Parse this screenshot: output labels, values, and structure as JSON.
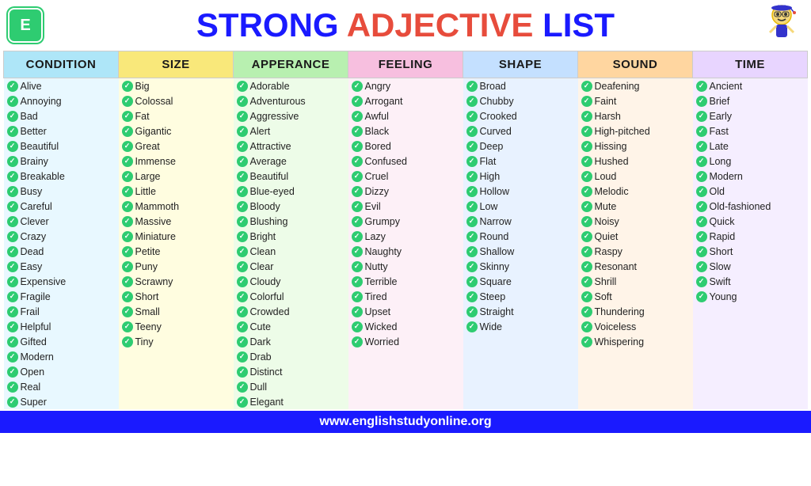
{
  "header": {
    "logo": "E",
    "title_strong": "STRONG",
    "title_adj": "ADJECTIVE",
    "title_list": "LIST"
  },
  "columns": [
    {
      "key": "condition",
      "label": "CONDITION",
      "class": "condition",
      "words": [
        "Alive",
        "Annoying",
        "Bad",
        "Better",
        "Beautiful",
        "Brainy",
        "Breakable",
        "Busy",
        "Careful",
        "Clever",
        "Crazy",
        "Dead",
        "Easy",
        "Expensive",
        "Fragile",
        "Frail",
        "Helpful",
        "Gifted",
        "Modern",
        "Open",
        "Real",
        "Super"
      ]
    },
    {
      "key": "size",
      "label": "SIZE",
      "class": "size",
      "words": [
        "Big",
        "Colossal",
        "Fat",
        "Gigantic",
        "Great",
        "Immense",
        "Large",
        "Little",
        "Mammoth",
        "Massive",
        "Miniature",
        "Petite",
        "Puny",
        "Scrawny",
        "Short",
        "Small",
        "Teeny",
        "Tiny"
      ]
    },
    {
      "key": "apperance",
      "label": "APPERANCE",
      "class": "apperance",
      "words": [
        "Adorable",
        "Adventurous",
        "Aggressive",
        "Alert",
        "Attractive",
        "Average",
        "Beautiful",
        "Blue-eyed",
        "Bloody",
        "Blushing",
        "Bright",
        "Clean",
        "Clear",
        "Cloudy",
        "Colorful",
        "Crowded",
        "Cute",
        "Dark",
        "Drab",
        "Distinct",
        "Dull",
        "Elegant"
      ]
    },
    {
      "key": "feeling",
      "label": "FEELING",
      "class": "feeling",
      "words": [
        "Angry",
        "Arrogant",
        "Awful",
        "Black",
        "Bored",
        "Confused",
        "Cruel",
        "Dizzy",
        "Evil",
        "Grumpy",
        "Lazy",
        "Naughty",
        "Nutty",
        "Terrible",
        "Tired",
        "Upset",
        "Wicked",
        "Worried"
      ]
    },
    {
      "key": "shape",
      "label": "SHAPE",
      "class": "shape",
      "words": [
        "Broad",
        "Chubby",
        "Crooked",
        "Curved",
        "Deep",
        "Flat",
        "High",
        "Hollow",
        "Low",
        "Narrow",
        "Round",
        "Shallow",
        "Skinny",
        "Square",
        "Steep",
        "Straight",
        "Wide"
      ]
    },
    {
      "key": "sound",
      "label": "SOUND",
      "class": "sound",
      "words": [
        "Deafening",
        "Faint",
        "Harsh",
        "High-pitched",
        "Hissing",
        "Hushed",
        "Loud",
        "Melodic",
        "Mute",
        "Noisy",
        "Quiet",
        "Raspy",
        "Resonant",
        "Shrill",
        "Soft",
        "Thundering",
        "Voiceless",
        "Whispering"
      ]
    },
    {
      "key": "time",
      "label": "TIME",
      "class": "time",
      "words": [
        "Ancient",
        "Brief",
        "Early",
        "Fast",
        "Late",
        "Long",
        "Modern",
        "Old",
        "Old-fashioned",
        "Quick",
        "Rapid",
        "Short",
        "Slow",
        "Swift",
        "Young"
      ]
    }
  ],
  "footer": {
    "url": "www.englishstudyonline.org"
  }
}
